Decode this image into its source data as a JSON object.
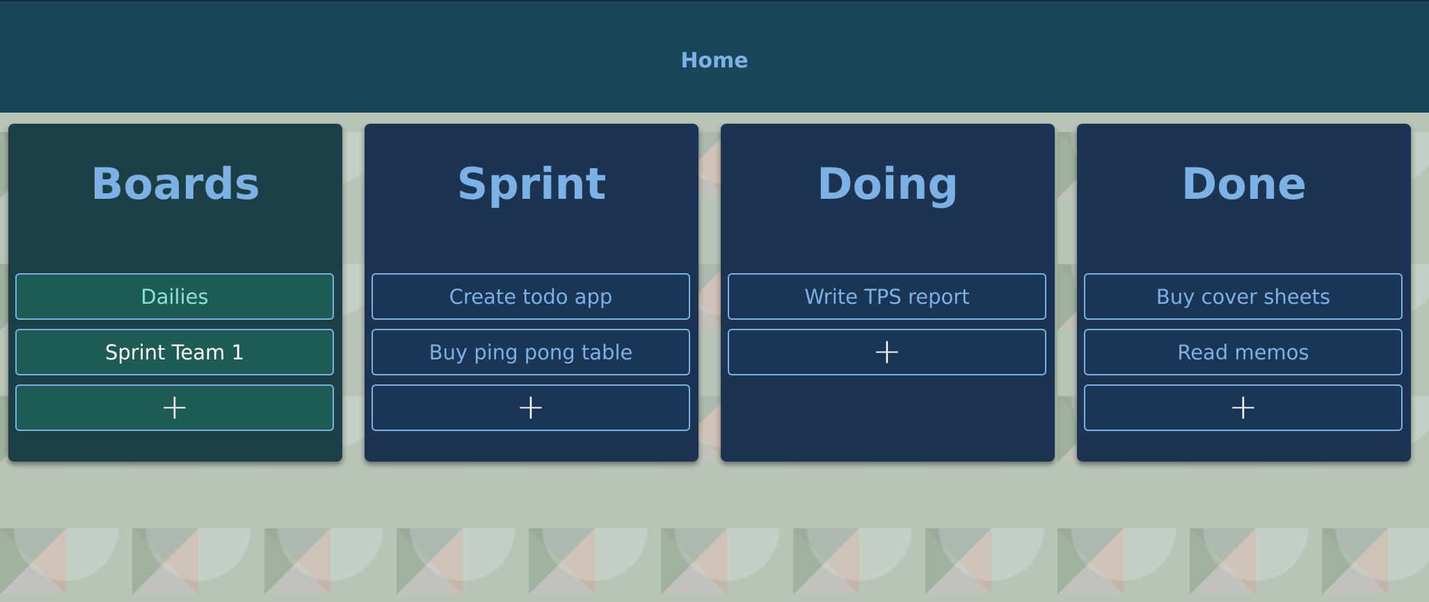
{
  "header": {
    "home_label": "Home"
  },
  "colors": {
    "header_bg": "#1b4659",
    "boards_bg": "#1c3f46",
    "list_bg": "#1c3351",
    "accent": "#7cb1e6",
    "active_board": "#8ee2cf"
  },
  "columns": [
    {
      "title": "Boards",
      "items": [
        "Dailies",
        "Sprint Team 1"
      ],
      "add_label": "+"
    },
    {
      "title": "Sprint",
      "items": [
        "Create todo app",
        "Buy ping pong table"
      ],
      "add_label": "+"
    },
    {
      "title": "Doing",
      "items": [
        "Write TPS report"
      ],
      "add_label": "+"
    },
    {
      "title": "Done",
      "items": [
        "Buy cover sheets",
        "Read memos"
      ],
      "add_label": "+"
    }
  ]
}
